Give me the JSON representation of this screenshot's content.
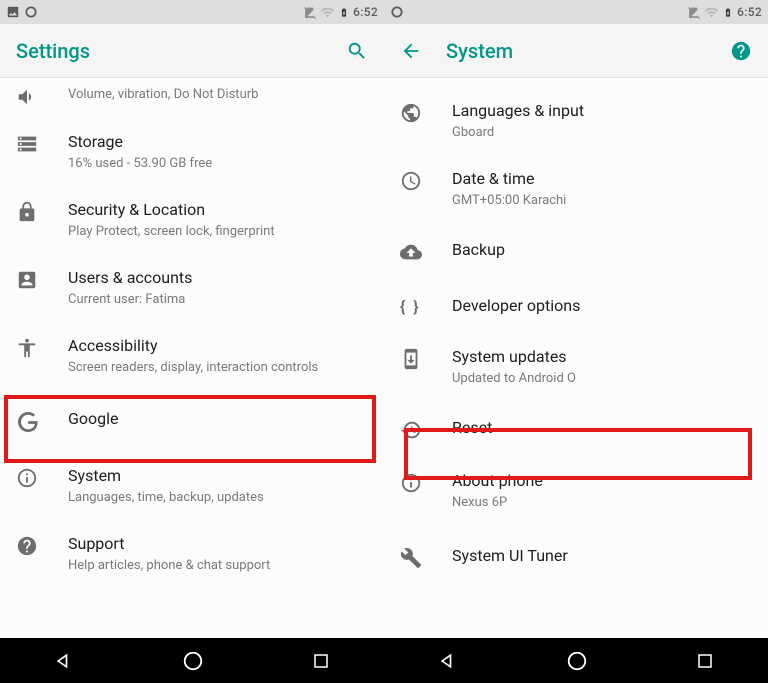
{
  "status": {
    "time": "6:52"
  },
  "left": {
    "title": "Settings",
    "items": [
      {
        "id": "sound",
        "primary": "",
        "secondary": "Volume, vibration, Do Not Disturb"
      },
      {
        "id": "storage",
        "primary": "Storage",
        "secondary": "16% used - 53.90 GB free"
      },
      {
        "id": "security",
        "primary": "Security & Location",
        "secondary": "Play Protect, screen lock, fingerprint"
      },
      {
        "id": "users",
        "primary": "Users & accounts",
        "secondary": "Current user: Fatima"
      },
      {
        "id": "accessibility",
        "primary": "Accessibility",
        "secondary": "Screen readers, display, interaction controls"
      },
      {
        "id": "google",
        "primary": "Google",
        "secondary": ""
      },
      {
        "id": "system",
        "primary": "System",
        "secondary": "Languages, time, backup, updates"
      },
      {
        "id": "support",
        "primary": "Support",
        "secondary": "Help articles, phone & chat support"
      }
    ]
  },
  "right": {
    "title": "System",
    "items": [
      {
        "id": "languages",
        "primary": "Languages & input",
        "secondary": "Gboard"
      },
      {
        "id": "datetime",
        "primary": "Date & time",
        "secondary": "GMT+05:00 Karachi"
      },
      {
        "id": "backup",
        "primary": "Backup",
        "secondary": ""
      },
      {
        "id": "developer",
        "primary": "Developer options",
        "secondary": ""
      },
      {
        "id": "updates",
        "primary": "System updates",
        "secondary": "Updated to Android O"
      },
      {
        "id": "reset",
        "primary": "Reset",
        "secondary": ""
      },
      {
        "id": "about",
        "primary": "About phone",
        "secondary": "Nexus 6P"
      },
      {
        "id": "tuner",
        "primary": "System UI Tuner",
        "secondary": ""
      }
    ]
  }
}
